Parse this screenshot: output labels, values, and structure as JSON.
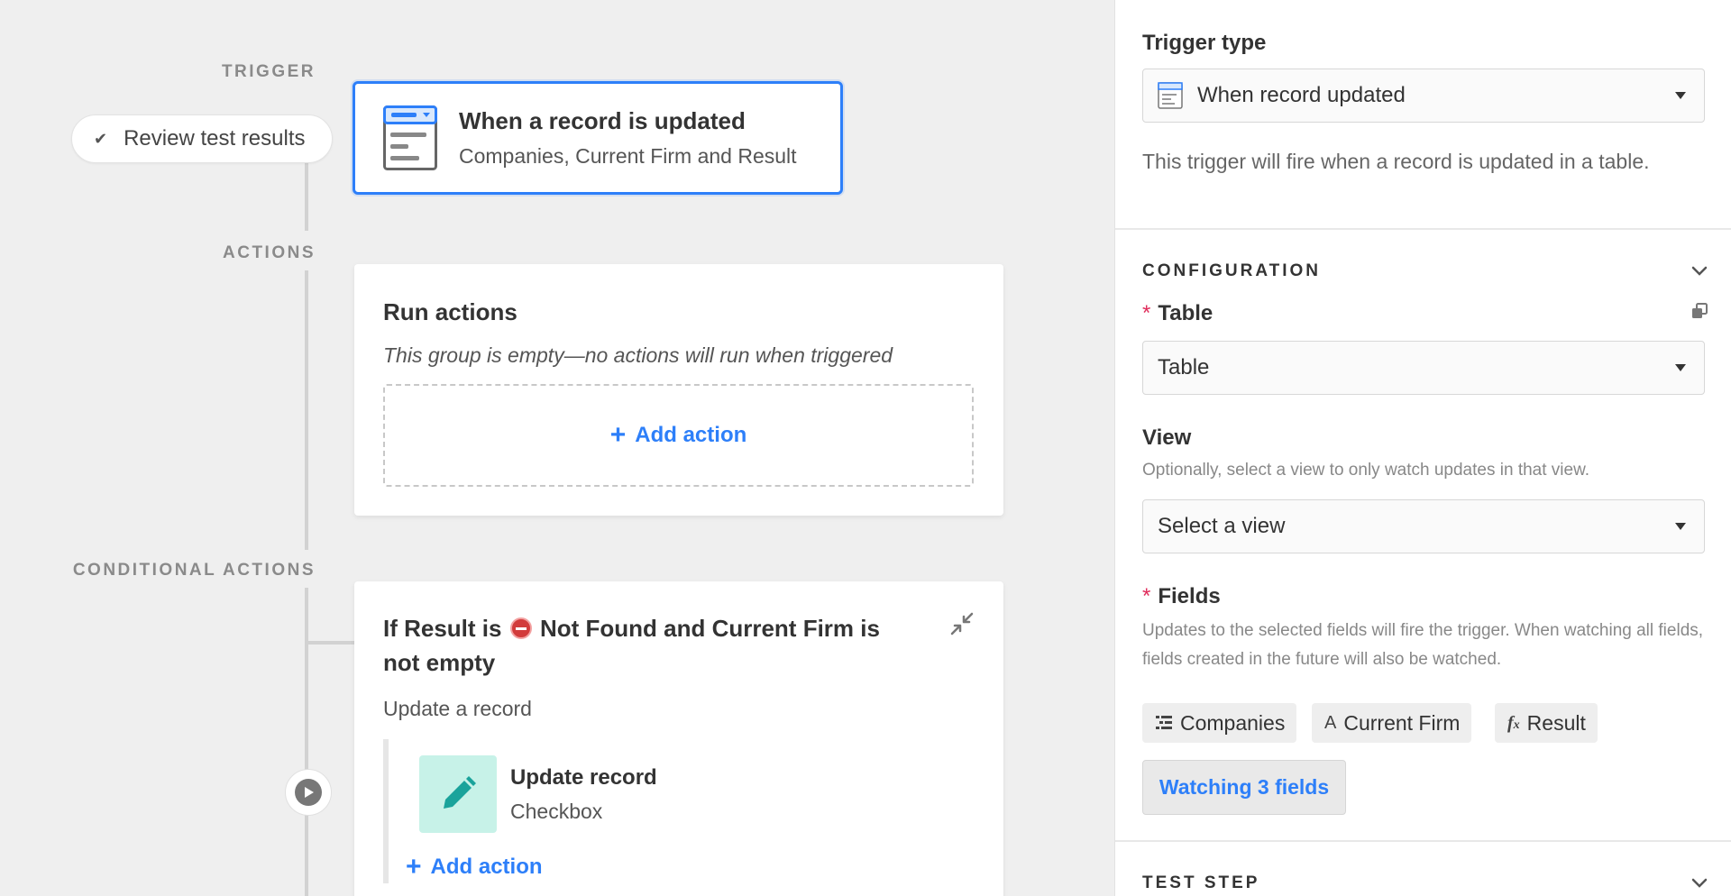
{
  "canvas": {
    "labels": {
      "trigger": "TRIGGER",
      "actions": "ACTIONS",
      "conditional": "CONDITIONAL ACTIONS"
    },
    "review_button": "Review test results",
    "trigger_card": {
      "title": "When a record is updated",
      "subtitle": "Companies, Current Firm and Result"
    },
    "run_card": {
      "title": "Run actions",
      "empty_text": "This group is empty—no actions will run when triggered",
      "add_action": "Add action"
    },
    "conditional_card": {
      "title_pre": "If Result is",
      "title_post": "Not Found and Current Firm is not empty",
      "subtitle": "Update a record",
      "action_title": "Update record",
      "action_sub": "Checkbox",
      "add_action": "Add action"
    }
  },
  "panel": {
    "trigger_type_label": "Trigger type",
    "trigger_type_value": "When record updated",
    "trigger_desc": "This trigger will fire when a record is updated in a table.",
    "configuration_title": "CONFIGURATION",
    "table_label": "Table",
    "table_value": "Table",
    "view_label": "View",
    "view_help": "Optionally, select a view to only watch updates in that view.",
    "view_value": "Select a view",
    "fields_label": "Fields",
    "fields_help": "Updates to the selected fields will fire the trigger. When watching all fields, fields created in the future will also be watched.",
    "chips": [
      {
        "icon": "linked-record-icon",
        "label": "Companies"
      },
      {
        "icon": "text-field-icon",
        "label": "Current Firm"
      },
      {
        "icon": "formula-icon",
        "label": "Result"
      }
    ],
    "watching_button": "Watching 3 fields",
    "test_step_title": "TEST STEP",
    "accent_color": "#2d7ff9"
  }
}
